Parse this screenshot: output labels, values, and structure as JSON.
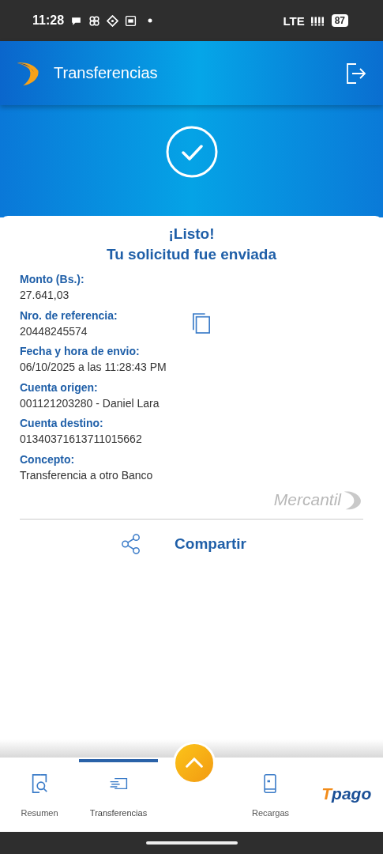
{
  "status_bar": {
    "time": "11:28",
    "network": "LTE",
    "battery": "87"
  },
  "app_bar": {
    "title": "Transferencias"
  },
  "receipt": {
    "heading": "¡Listo!",
    "subheading": "Tu solicitud fue enviada",
    "fields": [
      {
        "label": "Monto (Bs.):",
        "value": "27.641,03",
        "copyable": false
      },
      {
        "label": "Nro. de referencia:",
        "value": "20448245574",
        "copyable": true
      },
      {
        "label": "Fecha y hora de envio:",
        "value": "06/10/2025 a las 11:28:43 PM",
        "copyable": false
      },
      {
        "label": "Cuenta origen:",
        "value": "001121203280 - Daniel Lara",
        "copyable": false
      },
      {
        "label": "Cuenta destino:",
        "value": "01340371613711015662",
        "copyable": false
      },
      {
        "label": "Concepto:",
        "value": "Transferencia a otro Banco",
        "copyable": false
      }
    ],
    "brand": "Mercantil",
    "share": "Compartir"
  },
  "bottom_nav": {
    "items": [
      {
        "kind": "search",
        "label": "Resumen",
        "selected": false
      },
      {
        "kind": "transfer",
        "label": "Transferencias",
        "selected": true
      },
      {
        "kind": "fab"
      },
      {
        "kind": "phone",
        "label": "Recargas",
        "selected": false
      },
      {
        "kind": "logo",
        "first": "T",
        "rest": "pago"
      }
    ]
  }
}
